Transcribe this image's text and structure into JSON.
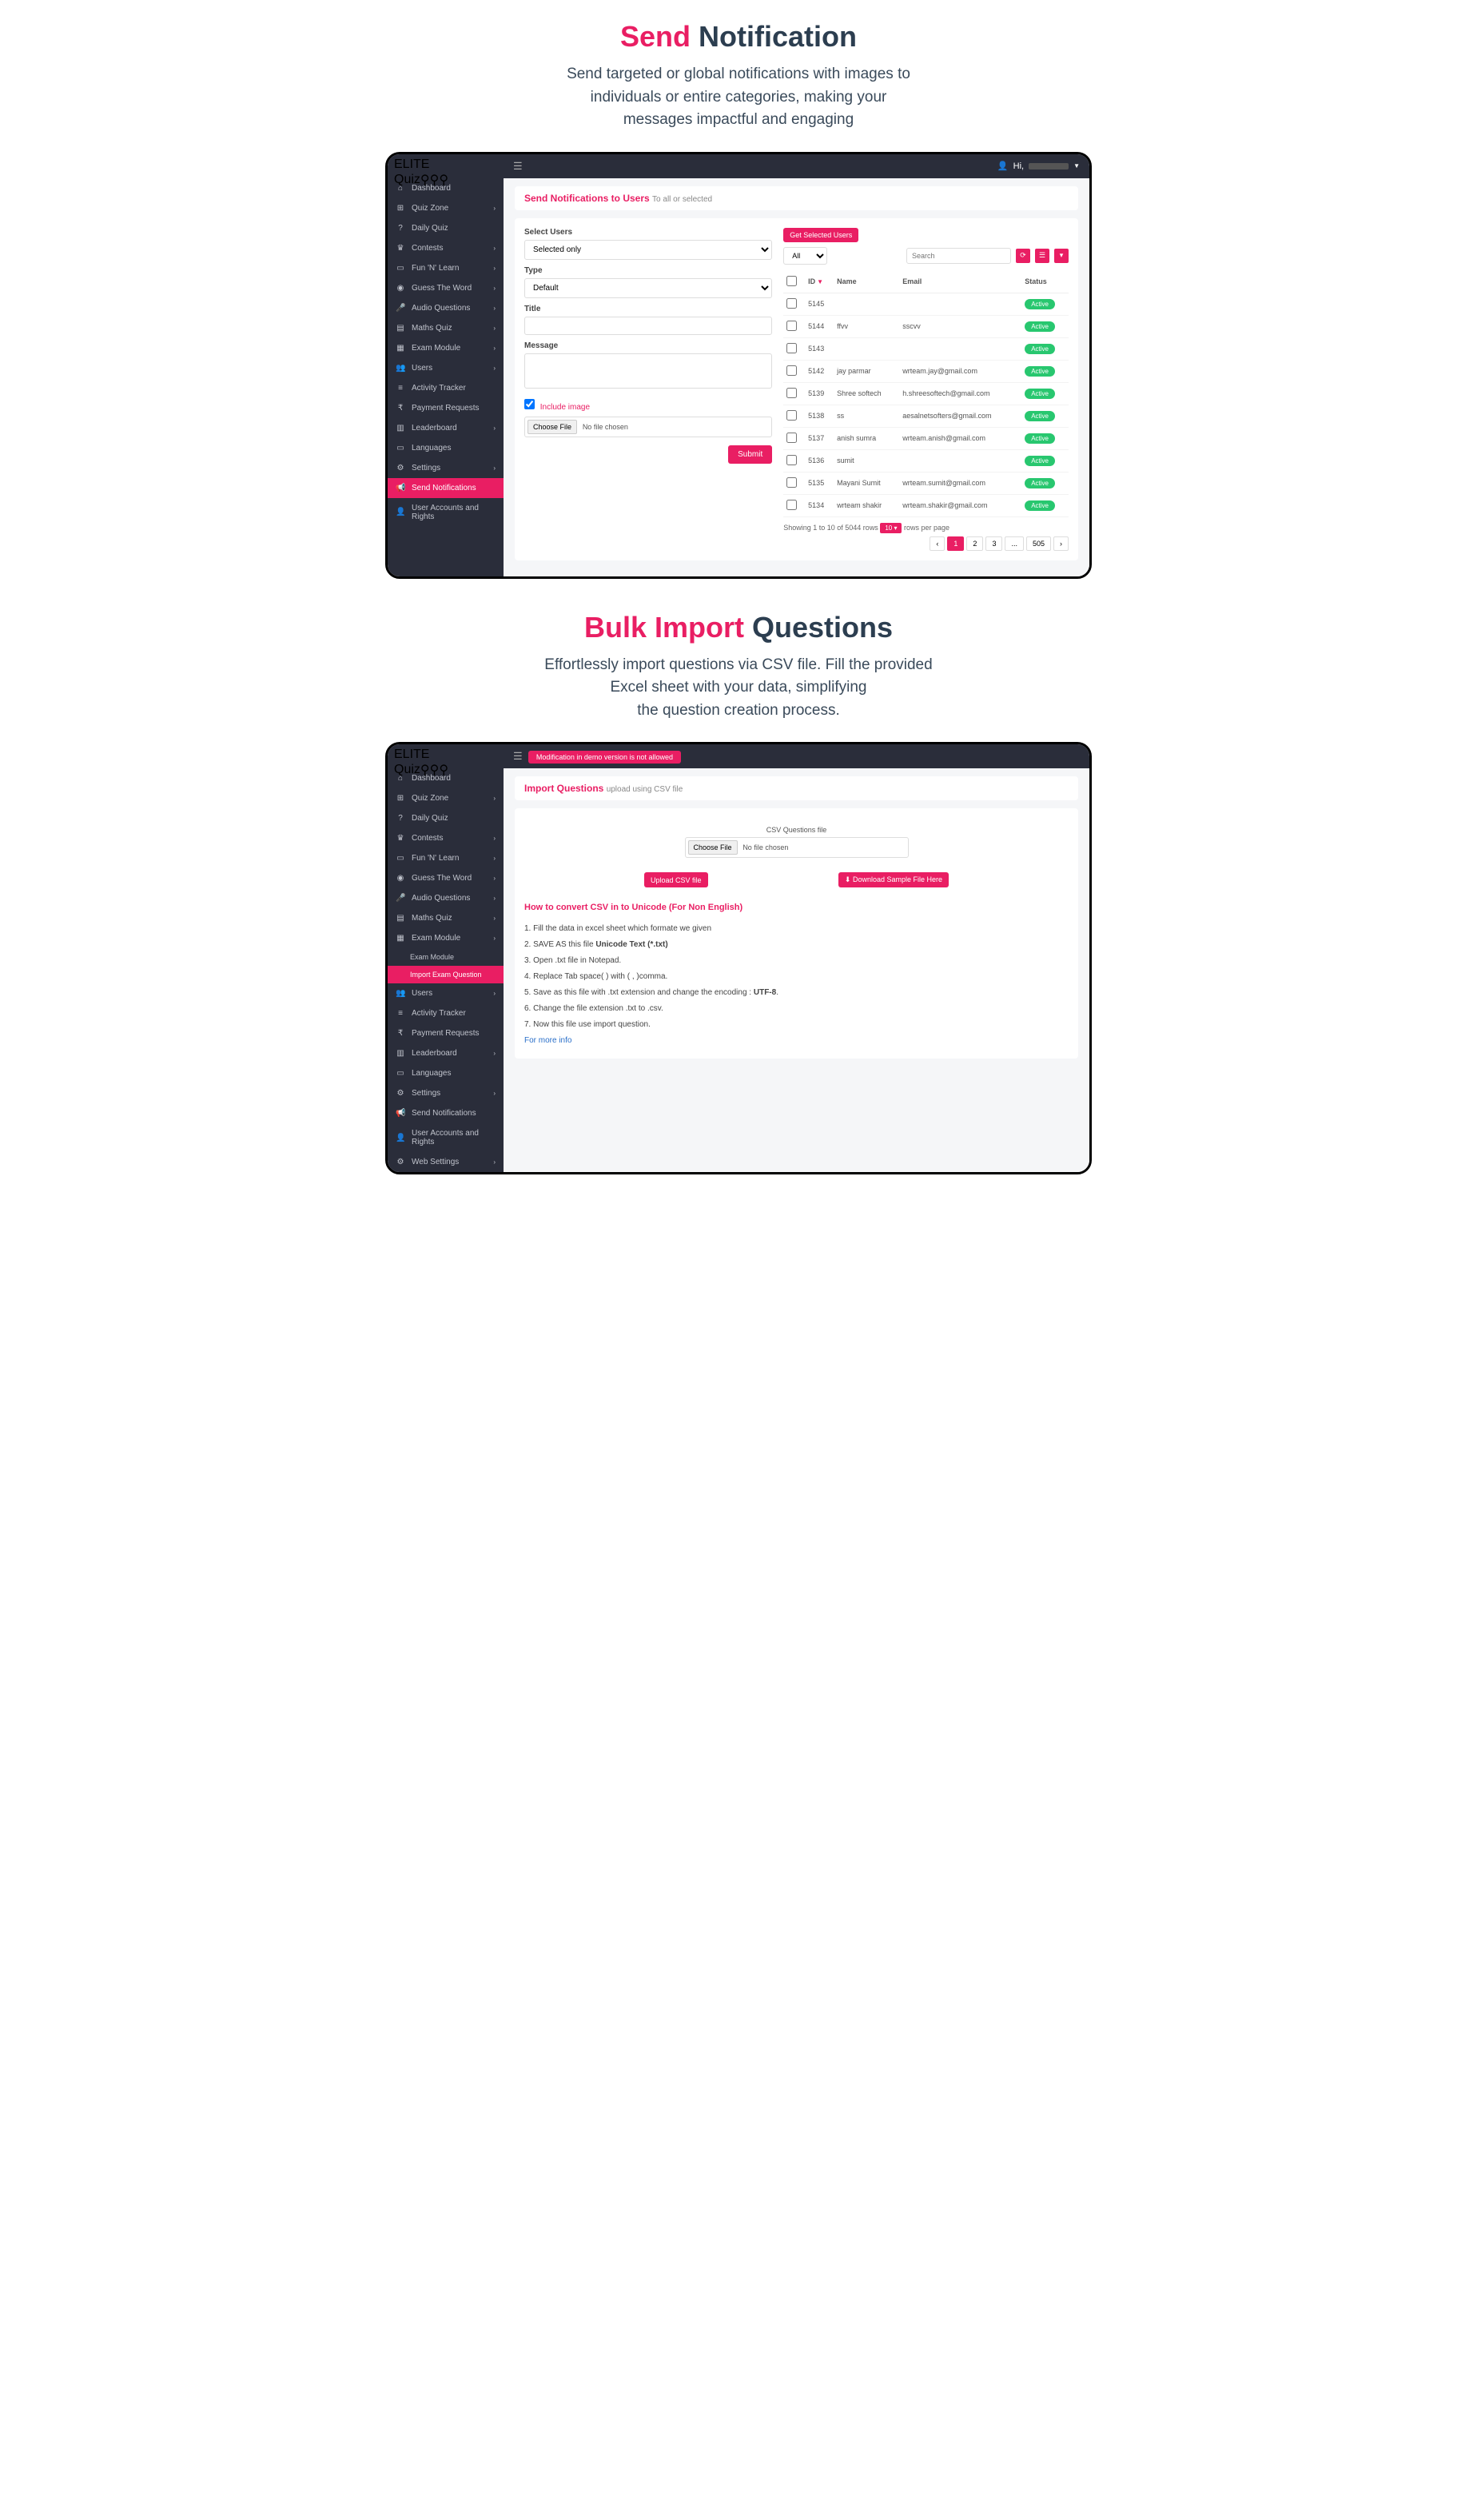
{
  "section1": {
    "title_a": "Send ",
    "title_b": "Notification",
    "desc_l1": "Send targeted or global notifications with images to",
    "desc_l2": "individuals or entire categories, making your",
    "desc_l3": "messages impactful and engaging"
  },
  "section2": {
    "title_a": "Bulk Import ",
    "title_b": "Questions",
    "desc_l1": "Effortlessly import questions via CSV file. Fill the provided",
    "desc_l2": "Excel sheet with your data, simplifying",
    "desc_l3": "the question creation process."
  },
  "logo": {
    "elite": "ELITE",
    "quiz": "Quiz"
  },
  "topbar": {
    "hi": "Hi,"
  },
  "sidebar1": [
    {
      "ico": "⌂",
      "label": "Dashboard"
    },
    {
      "ico": "⊞",
      "label": "Quiz Zone",
      "chev": "›"
    },
    {
      "ico": "?",
      "label": "Daily Quiz"
    },
    {
      "ico": "♛",
      "label": "Contests",
      "chev": "›"
    },
    {
      "ico": "▭",
      "label": "Fun 'N' Learn",
      "chev": "›"
    },
    {
      "ico": "◉",
      "label": "Guess The Word",
      "chev": "›"
    },
    {
      "ico": "🎤",
      "label": "Audio Questions",
      "chev": "›"
    },
    {
      "ico": "▤",
      "label": "Maths Quiz",
      "chev": "›"
    },
    {
      "ico": "▦",
      "label": "Exam Module",
      "chev": "›"
    },
    {
      "ico": "👥",
      "label": "Users",
      "chev": "›"
    },
    {
      "ico": "≡",
      "label": "Activity Tracker"
    },
    {
      "ico": "₹",
      "label": "Payment Requests"
    },
    {
      "ico": "▥",
      "label": "Leaderboard",
      "chev": "›"
    },
    {
      "ico": "▭",
      "label": "Languages"
    },
    {
      "ico": "⚙",
      "label": "Settings",
      "chev": "›"
    },
    {
      "ico": "📢",
      "label": "Send Notifications",
      "active": true
    },
    {
      "ico": "👤",
      "label": "User Accounts and Rights"
    }
  ],
  "sidebar2": [
    {
      "ico": "⌂",
      "label": "Dashboard"
    },
    {
      "ico": "⊞",
      "label": "Quiz Zone",
      "chev": "›"
    },
    {
      "ico": "?",
      "label": "Daily Quiz"
    },
    {
      "ico": "♛",
      "label": "Contests",
      "chev": "›"
    },
    {
      "ico": "▭",
      "label": "Fun 'N' Learn",
      "chev": "›"
    },
    {
      "ico": "◉",
      "label": "Guess The Word",
      "chev": "›"
    },
    {
      "ico": "🎤",
      "label": "Audio Questions",
      "chev": "›"
    },
    {
      "ico": "▤",
      "label": "Maths Quiz",
      "chev": "›"
    },
    {
      "ico": "▦",
      "label": "Exam Module",
      "chev": "›",
      "expanded": true
    },
    {
      "sub": true,
      "label": "Exam Module"
    },
    {
      "sub": true,
      "label": "Import Exam Question",
      "active": true
    },
    {
      "ico": "👥",
      "label": "Users",
      "chev": "›"
    },
    {
      "ico": "≡",
      "label": "Activity Tracker"
    },
    {
      "ico": "₹",
      "label": "Payment Requests"
    },
    {
      "ico": "▥",
      "label": "Leaderboard",
      "chev": "›"
    },
    {
      "ico": "▭",
      "label": "Languages"
    },
    {
      "ico": "⚙",
      "label": "Settings",
      "chev": "›"
    },
    {
      "ico": "📢",
      "label": "Send Notifications"
    },
    {
      "ico": "👤",
      "label": "User Accounts and Rights"
    },
    {
      "ico": "⚙",
      "label": "Web Settings",
      "chev": "›"
    }
  ],
  "panel1": {
    "header": "Send Notifications to Users",
    "header_sub": "To all or selected",
    "select_users": "Select Users",
    "selected_only": "Selected only",
    "type": "Type",
    "default": "Default",
    "title": "Title",
    "message": "Message",
    "include_image": "Include image",
    "choose_file": "Choose File",
    "no_file": "No file chosen",
    "submit": "Submit",
    "get_selected": "Get Selected Users",
    "all": "All",
    "search": "Search",
    "cols": {
      "id": "ID",
      "name": "Name",
      "email": "Email",
      "status": "Status"
    },
    "rows": [
      {
        "id": "5145",
        "name": "",
        "email": "",
        "status": "Active"
      },
      {
        "id": "5144",
        "name": "ffvv",
        "email": "sscvv",
        "status": "Active"
      },
      {
        "id": "5143",
        "name": "",
        "email": "",
        "status": "Active"
      },
      {
        "id": "5142",
        "name": "jay parmar",
        "email": "wrteam.jay@gmail.com",
        "status": "Active"
      },
      {
        "id": "5139",
        "name": "Shree softech",
        "email": "h.shreesoftech@gmail.com",
        "status": "Active"
      },
      {
        "id": "5138",
        "name": "ss",
        "email": "aesalnetsofters@gmail.com",
        "status": "Active"
      },
      {
        "id": "5137",
        "name": "anish sumra",
        "email": "wrteam.anish@gmail.com",
        "status": "Active"
      },
      {
        "id": "5136",
        "name": "sumit",
        "email": "",
        "status": "Active"
      },
      {
        "id": "5135",
        "name": "Mayani Sumit",
        "email": "wrteam.sumit@gmail.com",
        "status": "Active"
      },
      {
        "id": "5134",
        "name": "wrteam shakir",
        "email": "wrteam.shakir@gmail.com",
        "status": "Active"
      }
    ],
    "showing": "Showing 1 to 10 of 5044 rows",
    "rpp": "10 ▾",
    "rpp_txt": "rows per page",
    "pages": [
      "‹",
      "1",
      "2",
      "3",
      "...",
      "505",
      "›"
    ]
  },
  "panel2": {
    "alert": "Modification in demo version is not allowed",
    "header": "Import Questions",
    "header_sub": "upload using CSV file",
    "csv_label": "CSV Questions file",
    "choose_file": "Choose File",
    "no_file": "No file chosen",
    "upload": "Upload CSV file",
    "download": "⬇ Download Sample File Here",
    "inst_h": "How to convert CSV in to Unicode (For Non English)",
    "inst": [
      "1. Fill the data in excel sheet which formate we given",
      "2. SAVE AS this file Unicode Text (*.txt)",
      "3. Open .txt file in Notepad.",
      "4. Replace Tab space( ) with ( , )comma.",
      "5. Save as this file with .txt extension and change the encoding : UTF-8.",
      "6. Change the file extension .txt to .csv.",
      "7. Now this file use import question."
    ],
    "more_info": "For more info"
  }
}
